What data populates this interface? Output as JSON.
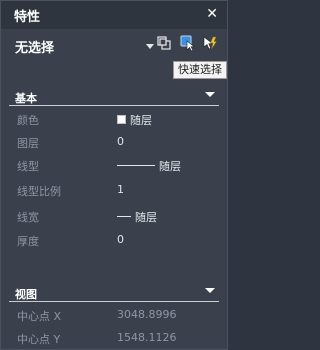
{
  "palette": {
    "title": "特性",
    "close_glyph": "✕",
    "selection": "无选择",
    "tooltip": "快速选择"
  },
  "toolbar": {
    "icons": [
      "select-objects-icon",
      "quick-select-icon",
      "toggle-pickadd-icon"
    ]
  },
  "sections": {
    "basic": {
      "title": "基本",
      "rows": [
        {
          "label": "颜色",
          "value": "随层"
        },
        {
          "label": "图层",
          "value": "0"
        },
        {
          "label": "线型",
          "value": "随层"
        },
        {
          "label": "线型比例",
          "value": "1"
        },
        {
          "label": "线宽",
          "value": "随层"
        },
        {
          "label": "厚度",
          "value": "0"
        }
      ]
    },
    "view": {
      "title": "视图",
      "rows": [
        {
          "label": "中心点 X",
          "value": "3048.8996"
        },
        {
          "label": "中心点 Y",
          "value": "1548.1126"
        }
      ]
    }
  },
  "colors": {
    "panel_bg": "#3a414d",
    "titlebar_bg": "#2f353f",
    "label_text": "#8e96a3",
    "value_text": "#e3e6ea",
    "header_text": "#ffffff",
    "quick_select_blue": "#3d8fe0",
    "pickadd_yellow": "#e8c23a"
  }
}
